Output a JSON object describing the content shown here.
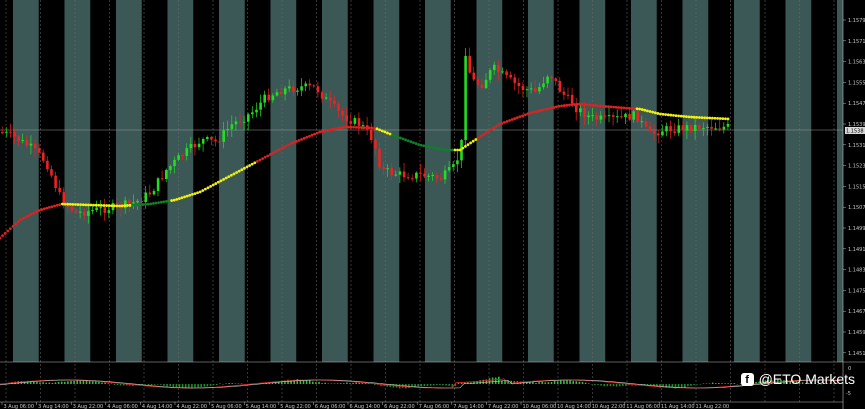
{
  "chart_data": {
    "type": "candlestick",
    "price_axis": [
      "1.1579",
      "1.1571",
      "1.1563",
      "1.1555",
      "1.1547",
      "1.1539",
      "1.1531",
      "1.1523",
      "1.1515",
      "1.1507",
      "1.1499",
      "1.1491",
      "1.1483",
      "1.1475",
      "1.1467",
      "1.1459",
      "1.1451"
    ],
    "current_price": "1.1538",
    "indicator_axis": [
      "0",
      "-5"
    ],
    "time_axis": [
      "3 Aug 06:00",
      "3 Aug 14:00",
      "3 Aug 22:00",
      "4 Aug 06:00",
      "4 Aug 14:00",
      "4 Aug 22:00",
      "5 Aug 06:00",
      "5 Aug 14:00",
      "5 Aug 22:00",
      "6 Aug 06:00",
      "6 Aug 14:00",
      "6 Aug 22:00",
      "7 Aug 06:00",
      "7 Aug 14:00",
      "7 Aug 22:00",
      "10 Aug 06:00",
      "10 Aug 14:00",
      "10 Aug 22:00",
      "11 Aug 06:00",
      "11 Aug 14:00",
      "11 Aug 22:00"
    ],
    "colors": {
      "bull": "#22dd22",
      "bear": "#ee2222",
      "ma_up": "#dd2222",
      "ma_flat": "#f2f20a",
      "ma_down": "#0f7f2a",
      "band": "#3b5856",
      "bg": "#000000"
    }
  },
  "watermark": {
    "icon": "facebook-icon",
    "text": "@ETO Markets"
  }
}
